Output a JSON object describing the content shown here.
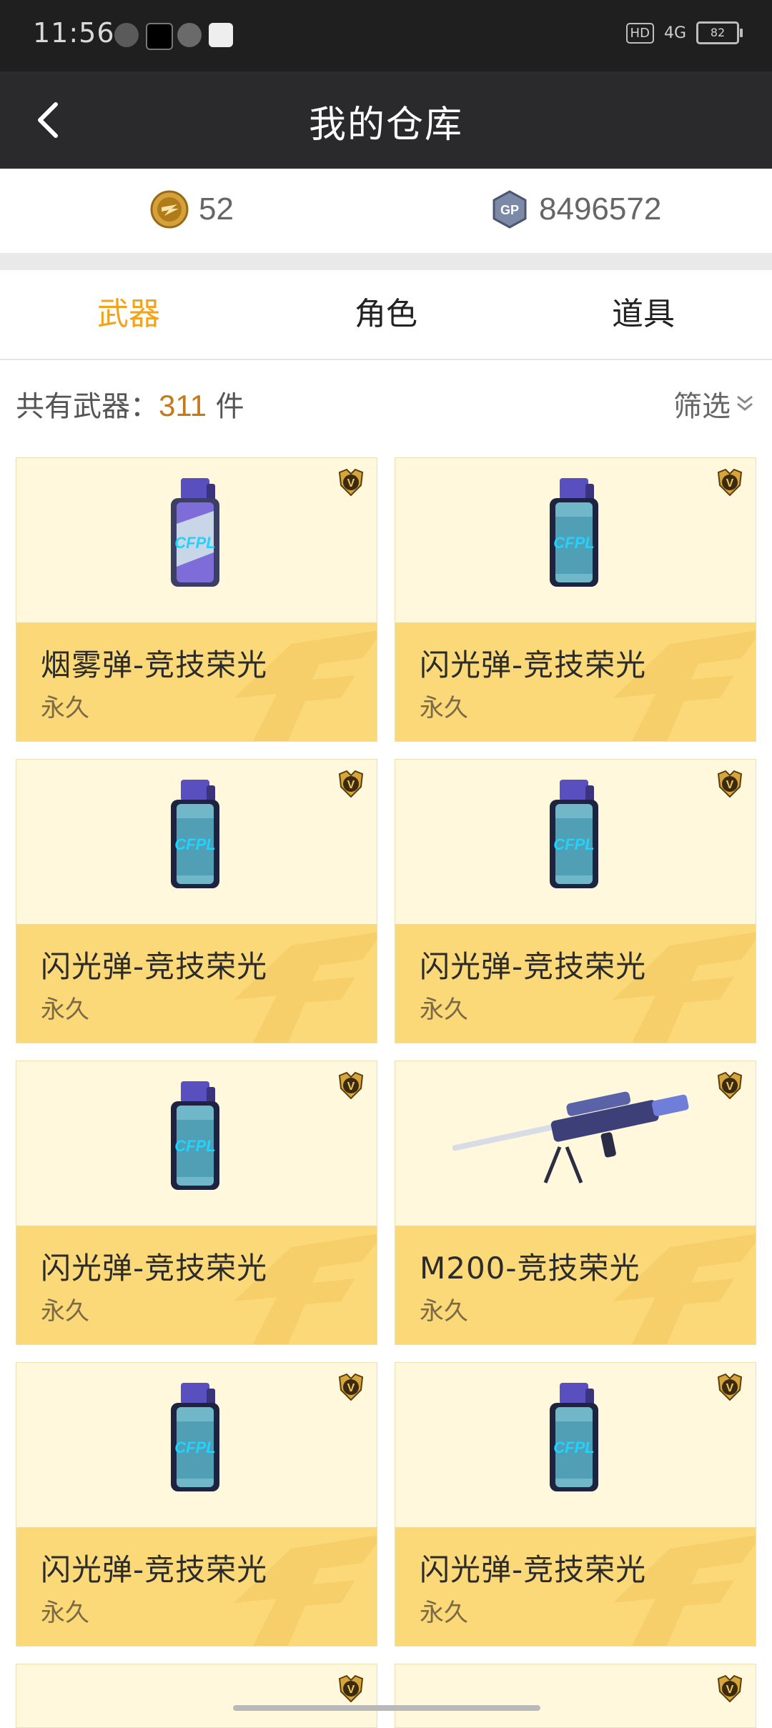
{
  "status_bar": {
    "time": "11:56",
    "hd": "HD",
    "signal": "4G",
    "battery": "82"
  },
  "nav": {
    "title": "我的仓库"
  },
  "currency": {
    "cf_points": "52",
    "gp": "8496572",
    "cf_icon": "cf-coin-icon",
    "gp_icon": "gp-coin-icon"
  },
  "tabs": [
    {
      "label": "武器",
      "active": true
    },
    {
      "label": "角色",
      "active": false
    },
    {
      "label": "道具",
      "active": false
    }
  ],
  "summary": {
    "prefix": "共有武器：",
    "count": "311",
    "suffix": " 件",
    "filter": "筛选"
  },
  "items": [
    {
      "name": "烟雾弹-竞技荣光",
      "duration": "永久",
      "type": "smoke-grenade"
    },
    {
      "name": "闪光弹-竞技荣光",
      "duration": "永久",
      "type": "flash-grenade"
    },
    {
      "name": "闪光弹-竞技荣光",
      "duration": "永久",
      "type": "flash-grenade"
    },
    {
      "name": "闪光弹-竞技荣光",
      "duration": "永久",
      "type": "flash-grenade"
    },
    {
      "name": "闪光弹-竞技荣光",
      "duration": "永久",
      "type": "flash-grenade"
    },
    {
      "name": "M200-竞技荣光",
      "duration": "永久",
      "type": "sniper-rifle"
    },
    {
      "name": "闪光弹-竞技荣光",
      "duration": "永久",
      "type": "flash-grenade"
    },
    {
      "name": "闪光弹-竞技荣光",
      "duration": "永久",
      "type": "flash-grenade"
    }
  ],
  "colors": {
    "accent": "#f2a21b",
    "card_bg": "#fff8dc",
    "card_band": "#fbd978",
    "header": "#2a2a2d"
  }
}
